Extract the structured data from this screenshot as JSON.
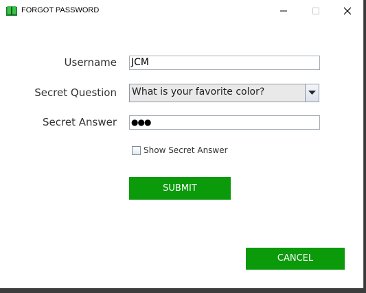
{
  "window": {
    "title": "FORGOT PASSWORD",
    "icon": "book-icon"
  },
  "form": {
    "username_label": "Username",
    "username_value": "JCM",
    "question_label": "Secret Question",
    "question_value": "What is your favorite color?",
    "answer_label": "Secret Answer",
    "answer_masked": "●●●",
    "show_answer_label": "Show Secret Answer",
    "show_answer_checked": false
  },
  "buttons": {
    "submit": "SUBMIT",
    "cancel": "CANCEL"
  },
  "colors": {
    "button_green": "#0a9a0a",
    "icon_green": "#1a9a3a"
  }
}
